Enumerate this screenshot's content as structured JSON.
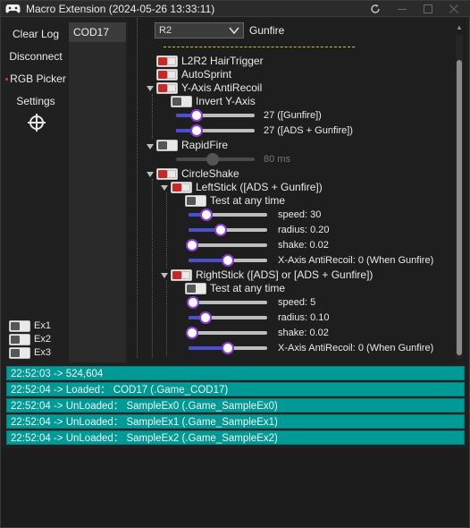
{
  "window": {
    "title": "Macro Extension (2024-05-26 13:33:11)"
  },
  "sidebar": {
    "clear_log": "Clear Log",
    "disconnect": "Disconnect",
    "rgb_picker": "RGB Picker",
    "settings": "Settings"
  },
  "profile": {
    "selected": "COD17"
  },
  "extras": [
    {
      "label": "Ex1",
      "on": false
    },
    {
      "label": "Ex2",
      "on": false
    },
    {
      "label": "Ex3",
      "on": false
    }
  ],
  "trigger": {
    "button_value": "R2",
    "label": "Gunfire"
  },
  "options": {
    "l2r2": "L2R2 HairTrigger",
    "autosprint": "AutoSprint",
    "y_axis": "Y-Axis AntiRecoil",
    "invert_y": "Invert Y-Axis",
    "y_gunfire_value": "27 ([Gunfire])",
    "y_ads_value": "27 ([ADS + Gunfire])",
    "rapidfire": "RapidFire",
    "rapidfire_value": "80 ms",
    "circleshake": "CircleShake",
    "leftstick": "LeftStick ([ADS + Gunfire])",
    "test_any_time": "Test at any time",
    "ls_speed": "speed: 30",
    "ls_radius": "radius: 0.20",
    "ls_shake": "shake: 0.02",
    "ls_xaxis": "X-Axis AntiRecoil: 0 (When Gunfire)",
    "rightstick": "RightStick ([ADS] or [ADS + Gunfire])",
    "test_any_time_2": "Test at any time",
    "rs_speed": "speed: 5",
    "rs_radius": "radius: 0.10",
    "rs_shake": "shake: 0.02",
    "rs_xaxis": "X-Axis AntiRecoil: 0 (When Gunfire)"
  },
  "log": [
    "22:52:03 -> 524,604",
    "22:52:04 -> Loaded： COD17 (.Game_COD17)",
    "22:52:04 -> UnLoaded： SampleEx0 (.Game_SampleEx0)",
    "22:52:04 -> UnLoaded： SampleEx1 (.Game_SampleEx1)",
    "22:52:04 -> UnLoaded： SampleEx2 (.Game_SampleEx2)"
  ],
  "colors": {
    "accent_red": "#c62828",
    "slider_thumb_border": "#8e3bd6",
    "log_highlight": "#009a96",
    "dash_yellow": "#d6c400"
  }
}
